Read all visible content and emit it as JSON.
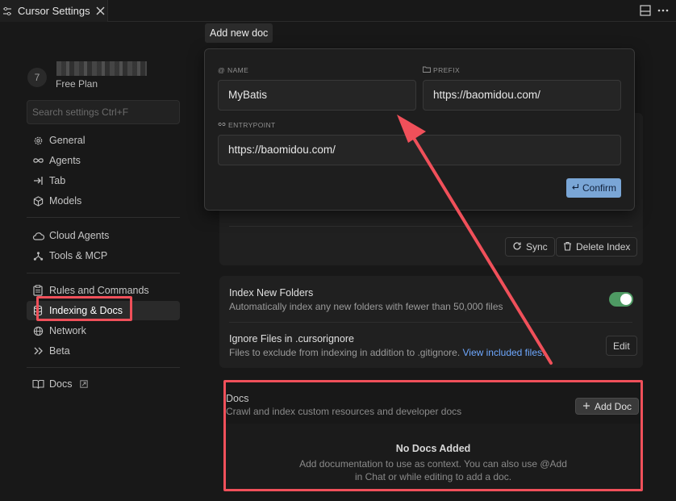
{
  "tab": {
    "title": "Cursor Settings",
    "icon": "settings-sliders-icon",
    "close_icon": "close-icon"
  },
  "account": {
    "avatar": "7",
    "plan": "Free Plan"
  },
  "search": {
    "placeholder": "Search settings Ctrl+F"
  },
  "sidebar": {
    "items": [
      {
        "label": "General",
        "icon": "gear-icon"
      },
      {
        "label": "Agents",
        "icon": "infinity-icon"
      },
      {
        "label": "Tab",
        "icon": "arrow-right-to-line-icon"
      },
      {
        "label": "Models",
        "icon": "cube-icon"
      },
      {
        "label": "Cloud Agents",
        "icon": "cloud-icon"
      },
      {
        "label": "Tools & MCP",
        "icon": "nodes-icon"
      },
      {
        "label": "Rules and Commands",
        "icon": "clipboard-icon"
      },
      {
        "label": "Indexing & Docs",
        "icon": "database-icon"
      },
      {
        "label": "Network",
        "icon": "globe-icon"
      },
      {
        "label": "Beta",
        "icon": "chevrons-right-icon"
      },
      {
        "label": "Docs",
        "icon": "book-icon"
      }
    ]
  },
  "popup": {
    "title": "Add new doc",
    "name_label": "NAME",
    "name_value": "MyBatis",
    "prefix_label": "PREFIX",
    "prefix_value": "https://baomidou.com/",
    "entrypoint_label": "ENTRYPOINT",
    "entrypoint_value": "https://baomidou.com/",
    "confirm_label": "Confirm"
  },
  "codebase": {
    "sync_label": "Sync",
    "delete_label": "Delete Index"
  },
  "index_new_folders": {
    "title": "Index New Folders",
    "desc": "Automatically index any new folders with fewer than 50,000 files",
    "enabled": true
  },
  "ignore_files": {
    "title": "Ignore Files in .cursorignore",
    "desc": "Files to exclude from indexing in addition to .gitignore.",
    "link": "View included files.",
    "edit_label": "Edit"
  },
  "docs": {
    "title": "Docs",
    "desc": "Crawl and index custom resources and developer docs",
    "add_label": "Add Doc",
    "empty_title": "No Docs Added",
    "empty_line1": "Add documentation to use as context. You can also use @Add",
    "empty_line2": "in Chat or while editing to add a doc."
  },
  "colors": {
    "highlight": "#f0505a",
    "toggle_on": "#4e9a63",
    "confirm": "#7aa6d6"
  }
}
